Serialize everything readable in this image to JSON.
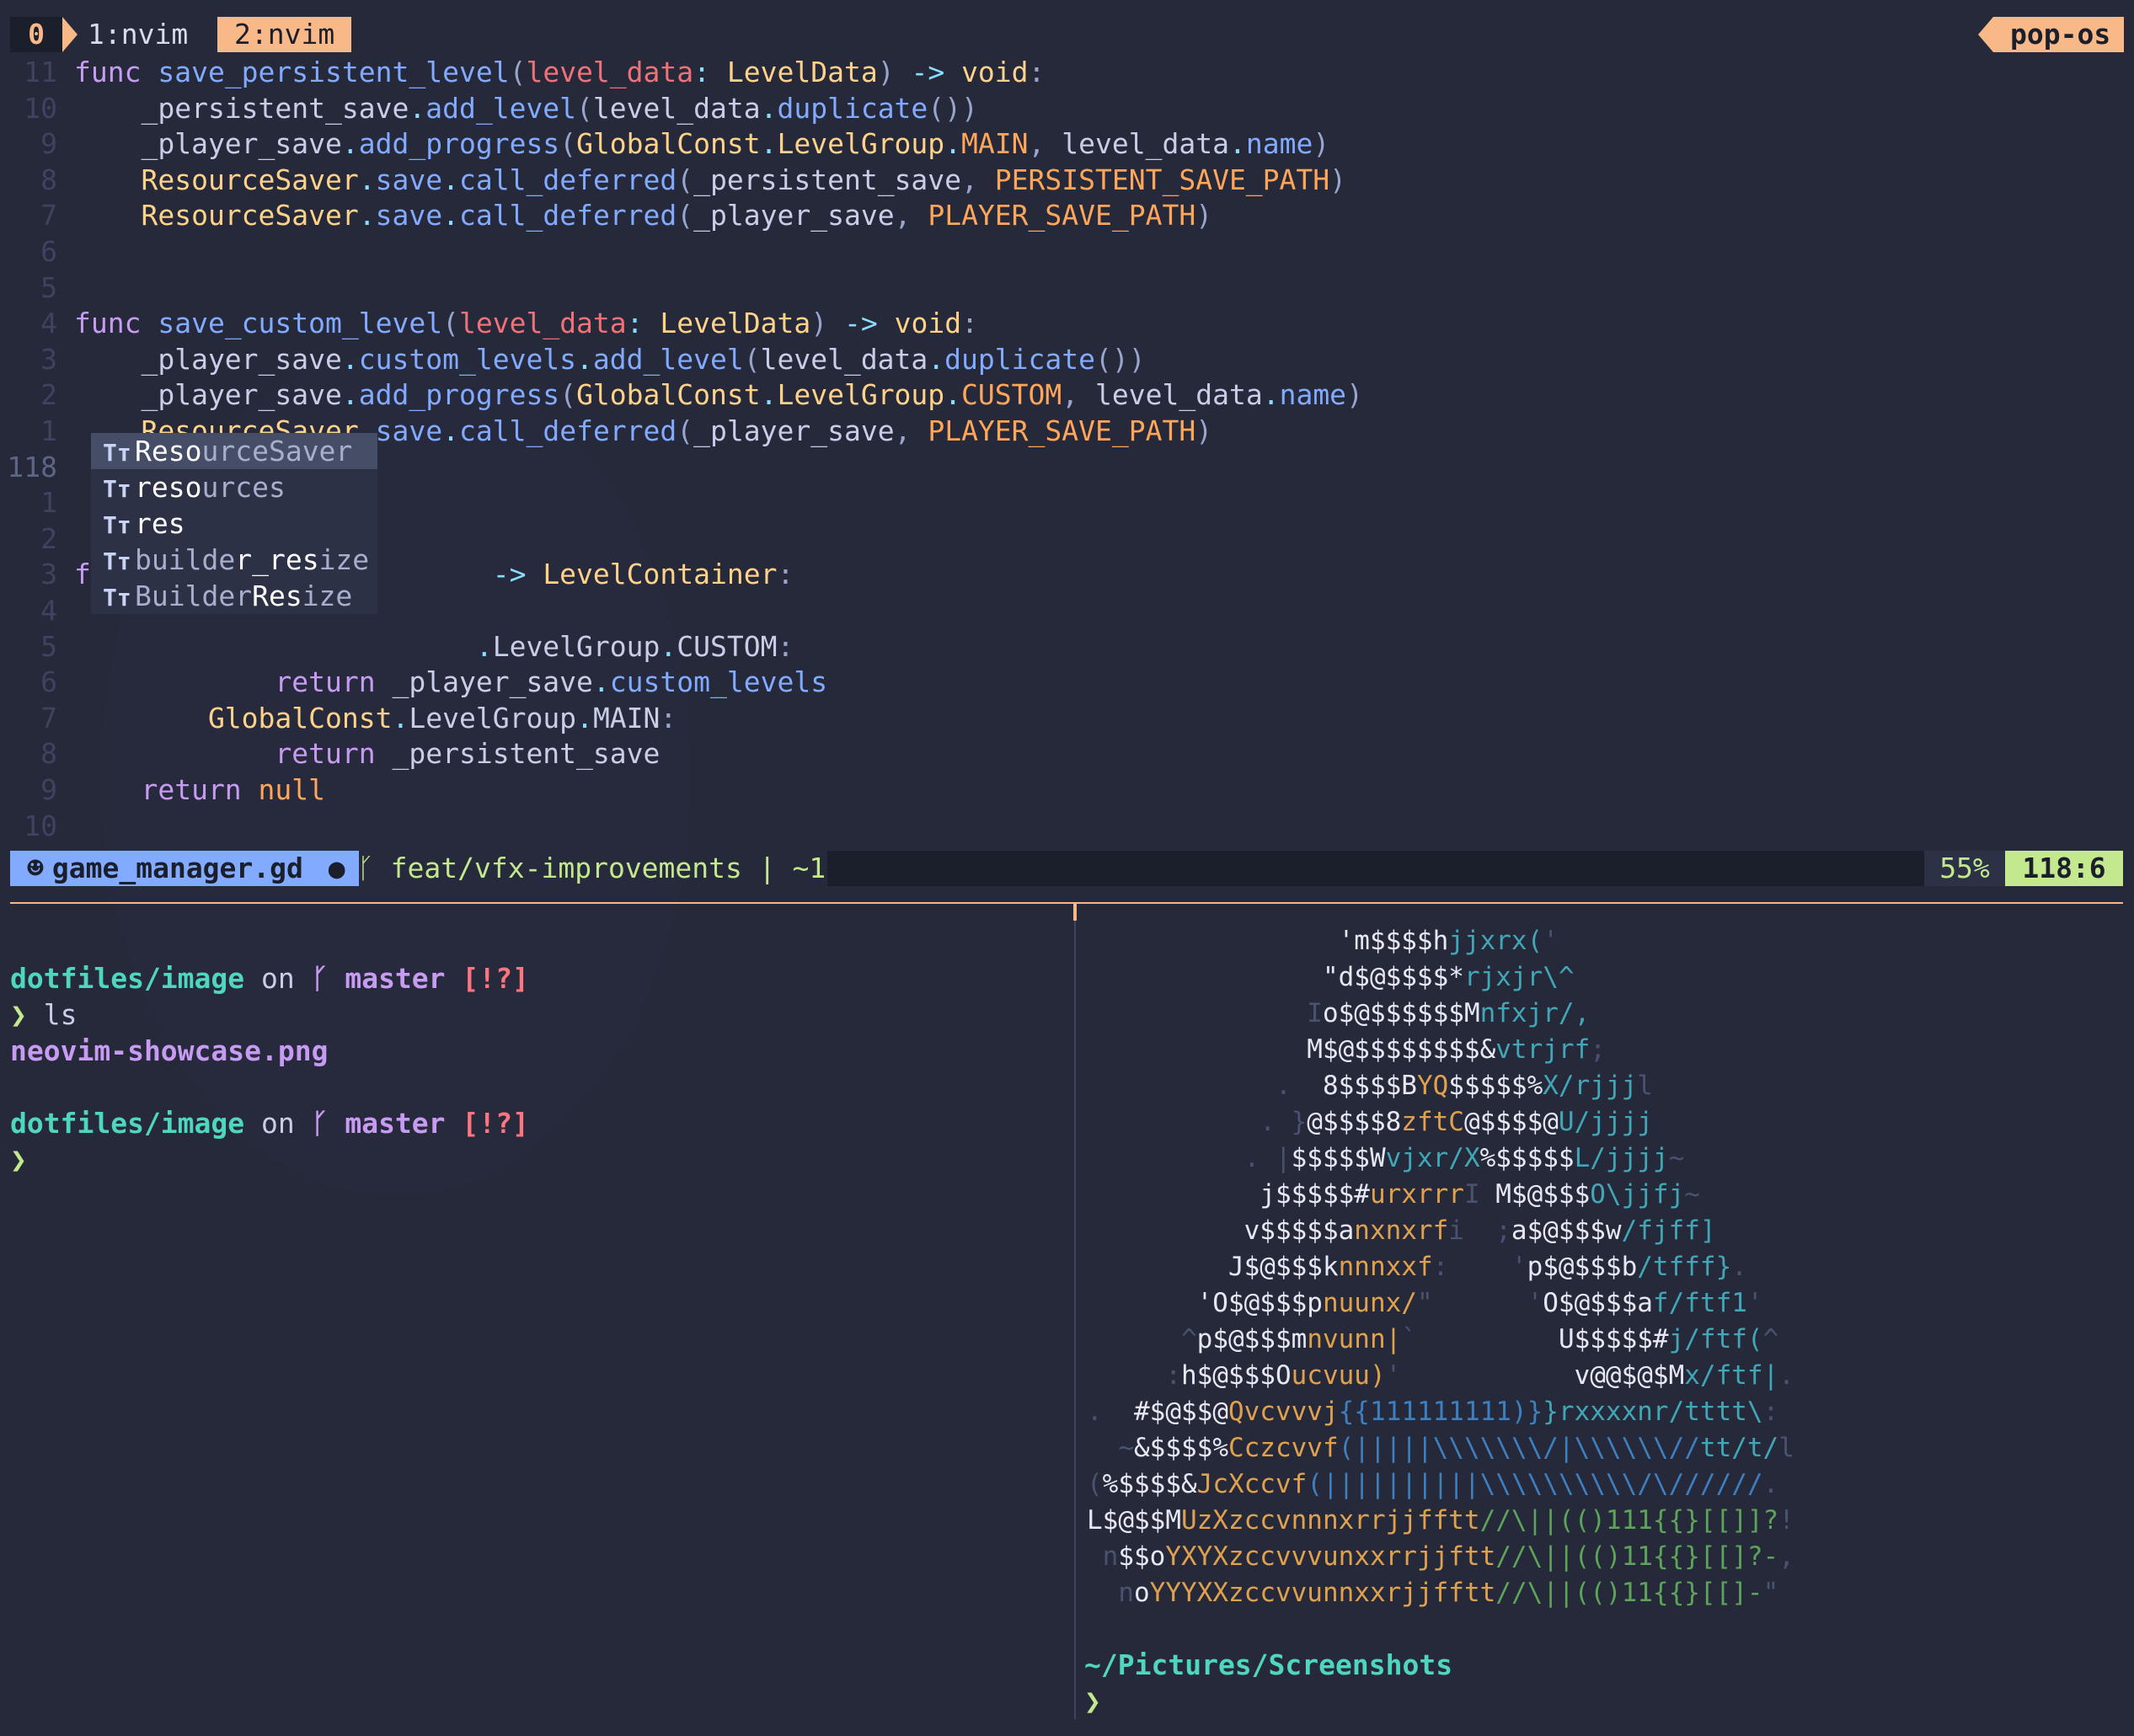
{
  "tmux": {
    "session": "0",
    "windows": [
      "1:nvim",
      "2:nvim"
    ],
    "host": "pop-os"
  },
  "editor": {
    "lines": [
      {
        "n": "11",
        "segs": [
          [
            "kw",
            "func "
          ],
          [
            "fn",
            "save_persistent_level"
          ],
          [
            "pn",
            "("
          ],
          [
            "pm",
            "level_data"
          ],
          [
            "op",
            ": "
          ],
          [
            "ty",
            "LevelData"
          ],
          [
            "pn",
            ") "
          ],
          [
            "op",
            "-> "
          ],
          [
            "ty",
            "void"
          ],
          [
            "pn",
            ":"
          ]
        ]
      },
      {
        "n": "10",
        "segs": [
          [
            "pl",
            "    _persistent_save"
          ],
          [
            "op",
            "."
          ],
          [
            "fn",
            "add_level"
          ],
          [
            "pn",
            "("
          ],
          [
            "pl",
            "level_data"
          ],
          [
            "op",
            "."
          ],
          [
            "fn",
            "duplicate"
          ],
          [
            "pn",
            "())"
          ]
        ]
      },
      {
        "n": "9",
        "segs": [
          [
            "pl",
            "    _player_save"
          ],
          [
            "op",
            "."
          ],
          [
            "fn",
            "add_progress"
          ],
          [
            "pn",
            "("
          ],
          [
            "ty",
            "GlobalConst"
          ],
          [
            "op",
            "."
          ],
          [
            "ty",
            "LevelGroup"
          ],
          [
            "op",
            "."
          ],
          [
            "co",
            "MAIN"
          ],
          [
            "pn",
            ", "
          ],
          [
            "pl",
            "level_data"
          ],
          [
            "op",
            "."
          ],
          [
            "fn",
            "name"
          ],
          [
            "pn",
            ")"
          ]
        ]
      },
      {
        "n": "8",
        "segs": [
          [
            "ty",
            "    ResourceSaver"
          ],
          [
            "op",
            "."
          ],
          [
            "fn",
            "save"
          ],
          [
            "op",
            "."
          ],
          [
            "fn",
            "call_deferred"
          ],
          [
            "pn",
            "("
          ],
          [
            "pl",
            "_persistent_save"
          ],
          [
            "pn",
            ", "
          ],
          [
            "co",
            "PERSISTENT_SAVE_PATH"
          ],
          [
            "pn",
            ")"
          ]
        ]
      },
      {
        "n": "7",
        "segs": [
          [
            "ty",
            "    ResourceSaver"
          ],
          [
            "op",
            "."
          ],
          [
            "fn",
            "save"
          ],
          [
            "op",
            "."
          ],
          [
            "fn",
            "call_deferred"
          ],
          [
            "pn",
            "("
          ],
          [
            "pl",
            "_player_save"
          ],
          [
            "pn",
            ", "
          ],
          [
            "co",
            "PLAYER_SAVE_PATH"
          ],
          [
            "pn",
            ")"
          ]
        ]
      },
      {
        "n": "6",
        "segs": []
      },
      {
        "n": "5",
        "segs": []
      },
      {
        "n": "4",
        "segs": [
          [
            "kw",
            "func "
          ],
          [
            "fn",
            "save_custom_level"
          ],
          [
            "pn",
            "("
          ],
          [
            "pm",
            "level_data"
          ],
          [
            "op",
            ": "
          ],
          [
            "ty",
            "LevelData"
          ],
          [
            "pn",
            ") "
          ],
          [
            "op",
            "-> "
          ],
          [
            "ty",
            "void"
          ],
          [
            "pn",
            ":"
          ]
        ]
      },
      {
        "n": "3",
        "segs": [
          [
            "pl",
            "    _player_save"
          ],
          [
            "op",
            "."
          ],
          [
            "fn",
            "custom_levels"
          ],
          [
            "op",
            "."
          ],
          [
            "fn",
            "add_level"
          ],
          [
            "pn",
            "("
          ],
          [
            "pl",
            "level_data"
          ],
          [
            "op",
            "."
          ],
          [
            "fn",
            "duplicate"
          ],
          [
            "pn",
            "())"
          ]
        ]
      },
      {
        "n": "2",
        "segs": [
          [
            "pl",
            "    _player_save"
          ],
          [
            "op",
            "."
          ],
          [
            "fn",
            "add_progress"
          ],
          [
            "pn",
            "("
          ],
          [
            "ty",
            "GlobalConst"
          ],
          [
            "op",
            "."
          ],
          [
            "ty",
            "LevelGroup"
          ],
          [
            "op",
            "."
          ],
          [
            "co",
            "CUSTOM"
          ],
          [
            "pn",
            ", "
          ],
          [
            "pl",
            "level_data"
          ],
          [
            "op",
            "."
          ],
          [
            "fn",
            "name"
          ],
          [
            "pn",
            ")"
          ]
        ]
      },
      {
        "n": "1",
        "segs": [
          [
            "ty",
            "    ResourceSaver"
          ],
          [
            "op",
            "."
          ],
          [
            "fn",
            "save"
          ],
          [
            "op",
            "."
          ],
          [
            "fn",
            "call_deferred"
          ],
          [
            "pn",
            "("
          ],
          [
            "pl",
            "_player_save"
          ],
          [
            "pn",
            ", "
          ],
          [
            "co",
            "PLAYER_SAVE_PATH"
          ],
          [
            "pn",
            ")"
          ]
        ]
      },
      {
        "n": "118",
        "current": true,
        "segs": [
          [
            "ty",
            "    Reso"
          ]
        ],
        "cursor": true
      },
      {
        "n": "1",
        "segs": []
      },
      {
        "n": "2",
        "segs": []
      },
      {
        "n": "3",
        "segs": [
          [
            "kw",
            "f"
          ],
          [
            "pl",
            "                        "
          ],
          [
            "op",
            "-> "
          ],
          [
            "ty",
            "LevelContainer"
          ],
          [
            "pn",
            ":"
          ]
        ]
      },
      {
        "n": "4",
        "segs": []
      },
      {
        "n": "5",
        "segs": [
          [
            "pl",
            "                        "
          ],
          [
            "op",
            "."
          ],
          [
            "pl",
            "LevelGroup"
          ],
          [
            "op",
            "."
          ],
          [
            "pl",
            "CUSTOM"
          ],
          [
            "pn",
            ":"
          ]
        ]
      },
      {
        "n": "6",
        "segs": [
          [
            "kw",
            "            return "
          ],
          [
            "pl",
            "_player_save"
          ],
          [
            "op",
            "."
          ],
          [
            "fn",
            "custom_levels"
          ]
        ]
      },
      {
        "n": "7",
        "segs": [
          [
            "ty",
            "        GlobalConst"
          ],
          [
            "op",
            "."
          ],
          [
            "pl",
            "LevelGroup"
          ],
          [
            "op",
            "."
          ],
          [
            "pl",
            "MAIN"
          ],
          [
            "pn",
            ":"
          ]
        ]
      },
      {
        "n": "8",
        "segs": [
          [
            "kw",
            "            return "
          ],
          [
            "pl",
            "_persistent_save"
          ]
        ]
      },
      {
        "n": "9",
        "segs": [
          [
            "kw",
            "    return "
          ],
          [
            "co",
            "null"
          ]
        ]
      },
      {
        "n": "10",
        "segs": []
      }
    ],
    "completion": [
      {
        "kind": "Tт",
        "match": "Reso",
        "rest": "urceSaver",
        "selected": true
      },
      {
        "kind": "Tт",
        "match": "reso",
        "rest": "urces"
      },
      {
        "kind": "Tт",
        "match": "res",
        "rest": ""
      },
      {
        "kind": "Tт",
        "pre": "builde",
        "match": "r_res",
        "rest": "ize"
      },
      {
        "kind": "Tт",
        "pre": "Builder",
        "match": "Res",
        "rest": "ize"
      }
    ]
  },
  "statusline": {
    "filename": "game_manager.gd",
    "modified": "●",
    "branch": "feat/vfx-improvements | ~1",
    "percent": "55%",
    "position": "118:6"
  },
  "shell": {
    "dir": "dotfiles/image",
    "on": "on",
    "branch": "master",
    "flags": "[!?]",
    "prompt_char": "❯",
    "command": "ls",
    "output": "neovim-showcase.png"
  },
  "ascii_art": [
    [
      [
        "a-w",
        "                'm$$$$h"
      ],
      [
        "a-g",
        "jjxrx("
      ],
      [
        "a-d",
        "'"
      ]
    ],
    [
      [
        "a-w",
        "               \"d$@$$$$*"
      ],
      [
        "a-g",
        "rjxjr\\^"
      ]
    ],
    [
      [
        "a-d",
        "              I"
      ],
      [
        "a-w",
        "o$@$$$$$$M"
      ],
      [
        "a-g",
        "nfxjr/,"
      ]
    ],
    [
      [
        "a-w",
        "              M$@$$$$$$$$&"
      ],
      [
        "a-g",
        "vtrjrf"
      ],
      [
        "a-d",
        ";"
      ]
    ],
    [
      [
        "a-d",
        "            .  "
      ],
      [
        "a-w",
        "8$$$$B"
      ],
      [
        "a-o",
        "YQ"
      ],
      [
        "a-w",
        "$$$$$%"
      ],
      [
        "a-g",
        "X/rjjj"
      ],
      [
        "a-d",
        "l"
      ]
    ],
    [
      [
        "a-d",
        "           . }"
      ],
      [
        "a-w",
        "@$$$$8"
      ],
      [
        "a-o",
        "zftC"
      ],
      [
        "a-w",
        "@$$$$@"
      ],
      [
        "a-g",
        "U/jjjj"
      ]
    ],
    [
      [
        "a-d",
        "          . |"
      ],
      [
        "a-w",
        "$$$$$W"
      ],
      [
        "a-g",
        "vjxr/X"
      ],
      [
        "a-w",
        "%$$$$$"
      ],
      [
        "a-g",
        "L/jjjj"
      ],
      [
        "a-d",
        "~"
      ]
    ],
    [
      [
        "a-d",
        "           "
      ],
      [
        "a-w",
        "j$$$$$#"
      ],
      [
        "a-o",
        "urxrrr"
      ],
      [
        "a-d",
        "I "
      ],
      [
        "a-w",
        "M$@$$$"
      ],
      [
        "a-g",
        "O\\jjfj"
      ],
      [
        "a-d",
        "~"
      ]
    ],
    [
      [
        "a-w",
        "          v$$$$$a"
      ],
      [
        "a-o",
        "nxnxrf"
      ],
      [
        "a-d",
        "i  ;"
      ],
      [
        "a-w",
        "a$@$$$w"
      ],
      [
        "a-g",
        "/fjff]"
      ]
    ],
    [
      [
        "a-w",
        "         J$@$$$k"
      ],
      [
        "a-o",
        "nnnxxf"
      ],
      [
        "a-d",
        ":    '"
      ],
      [
        "a-w",
        "p$@$$$b"
      ],
      [
        "a-g",
        "/tfff}"
      ],
      [
        "a-d",
        "."
      ]
    ],
    [
      [
        "a-w",
        "       'O$@$$$p"
      ],
      [
        "a-o",
        "nuunx/"
      ],
      [
        "a-d",
        "\"      '"
      ],
      [
        "a-w",
        "O$@$$$a"
      ],
      [
        "a-g",
        "f/ftf1"
      ],
      [
        "a-d",
        "'"
      ]
    ],
    [
      [
        "a-d",
        "      ^"
      ],
      [
        "a-w",
        "p$@$$$m"
      ],
      [
        "a-o",
        "nvunn|"
      ],
      [
        "a-d",
        "`         "
      ],
      [
        "a-w",
        "U$$$$$#"
      ],
      [
        "a-g",
        "j/ftf("
      ],
      [
        "a-d",
        "^"
      ]
    ],
    [
      [
        "a-d",
        "     :"
      ],
      [
        "a-w",
        "h$@$$$O"
      ],
      [
        "a-o",
        "ucvuu)"
      ],
      [
        "a-d",
        "'           "
      ],
      [
        "a-w",
        "v@@$@$M"
      ],
      [
        "a-g",
        "x/ftf|"
      ],
      [
        "a-d",
        "."
      ]
    ],
    [
      [
        "a-d",
        ".  "
      ],
      [
        "a-w",
        "#$@$$@"
      ],
      [
        "a-o",
        "Qvcvvvj"
      ],
      [
        "a-b",
        "{{111111111)}"
      ],
      [
        "a-g",
        "}rxxxxnr/tttt\\"
      ],
      [
        "a-d",
        ":"
      ]
    ],
    [
      [
        "a-d",
        "  ~"
      ],
      [
        "a-w",
        "&$$$$%"
      ],
      [
        "a-o",
        "Cczcvvf"
      ],
      [
        "a-b",
        "(|||||\\\\\\\\\\\\\\/|\\\\\\\\\\\\//"
      ],
      [
        "a-g",
        "tt/t/"
      ],
      [
        "a-d",
        "l"
      ]
    ],
    [
      [
        "a-d",
        "("
      ],
      [
        "a-w",
        "%$$$$&"
      ],
      [
        "a-o",
        "JcXccvf"
      ],
      [
        "a-b",
        "(||||||||||\\\\\\\\\\\\\\\\\\\\/\\//////"
      ],
      [
        "a-d",
        "."
      ]
    ],
    [
      [
        "a-w",
        "L$@$$M"
      ],
      [
        "a-o",
        "UzXzccvnnnxrrjjfftt"
      ],
      [
        "a-dg",
        "//\\||(()111{{}[[]]?"
      ],
      [
        "a-d",
        "!"
      ]
    ],
    [
      [
        "a-d",
        " n"
      ],
      [
        "a-w",
        "$$o"
      ],
      [
        "a-o",
        "YXYXzccvvvunxxrrjjftt"
      ],
      [
        "a-dg",
        "//\\||(()11{{}[[]?-"
      ],
      [
        "a-d",
        ","
      ]
    ],
    [
      [
        "a-d",
        "  n"
      ],
      [
        "a-w",
        "o"
      ],
      [
        "a-o",
        "YYYXXzccvvunnxxrjjfftt"
      ],
      [
        "a-dg",
        "//\\||(()11{{}[[]-"
      ],
      [
        "a-d",
        "\""
      ]
    ]
  ],
  "shell2": {
    "dir": "~/Pictures/Screenshots",
    "prompt_char": "❯"
  }
}
